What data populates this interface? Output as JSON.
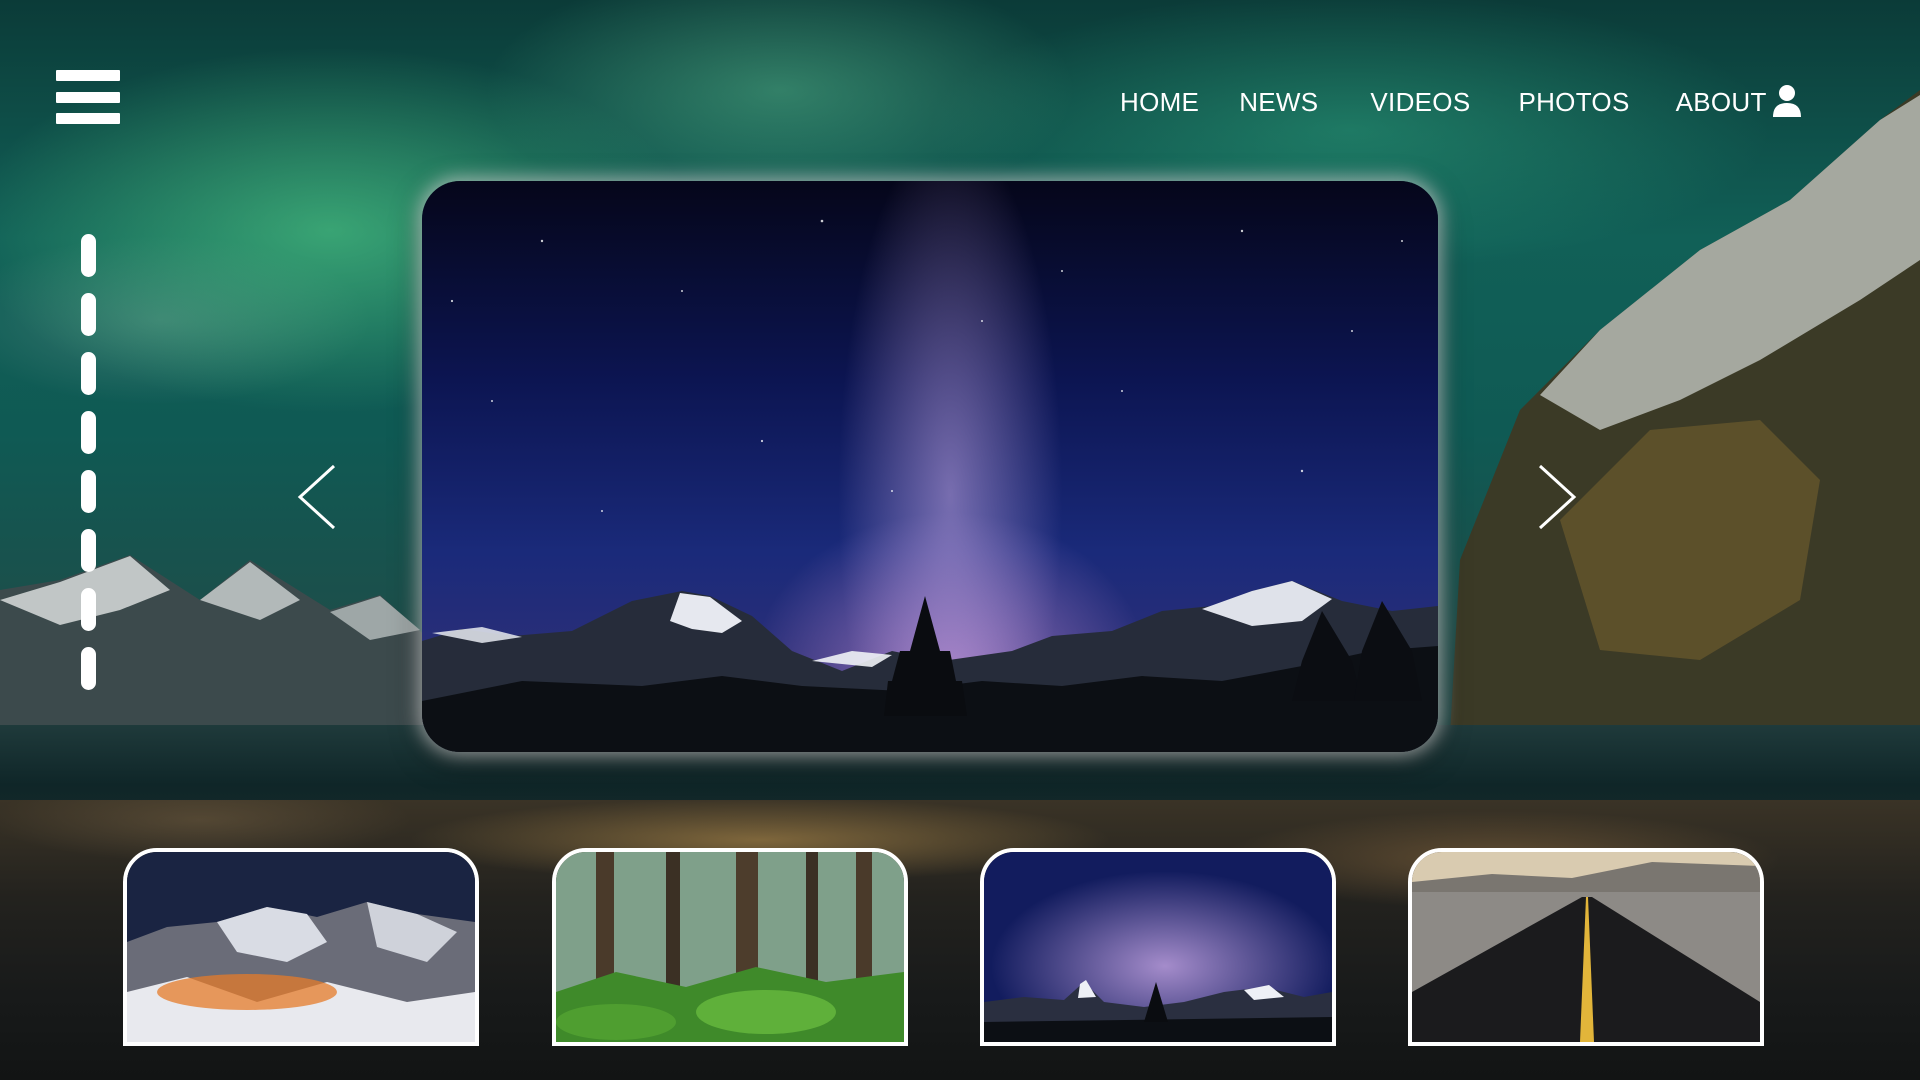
{
  "nav": {
    "items": [
      "HOME",
      "NEWS",
      "VIDEOS",
      "PHOTOS",
      "ABOUT"
    ],
    "menu_icon": "hamburger-menu-icon",
    "user_icon": "user-icon"
  },
  "pager": {
    "count": 8
  },
  "carousel": {
    "prev_icon": "chevron-left-icon",
    "next_icon": "chevron-right-icon",
    "thumbnails": [
      {
        "subject": "snowy mountains at night"
      },
      {
        "subject": "mossy green forest"
      },
      {
        "subject": "milky way over mountains"
      },
      {
        "subject": "desert highway"
      }
    ]
  },
  "colors": {
    "accent": "#ffffff",
    "sky": "#0f5a54"
  }
}
